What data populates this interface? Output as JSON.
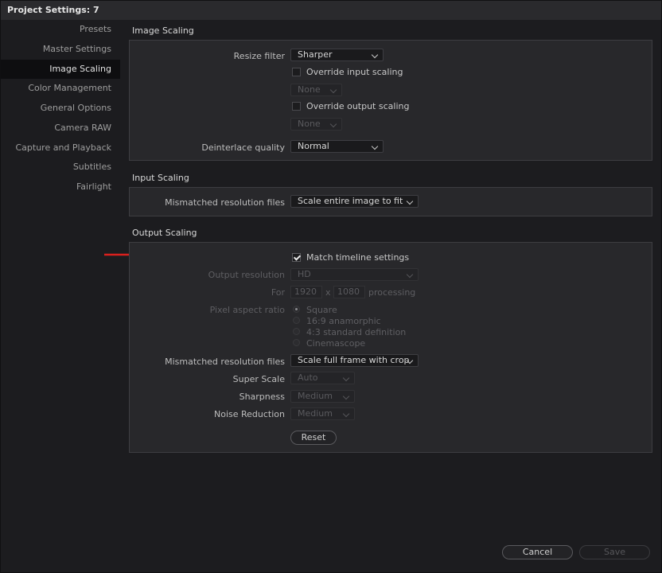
{
  "window": {
    "title": "Project Settings:  7"
  },
  "sidebar": {
    "items": [
      {
        "label": "Presets",
        "active": false
      },
      {
        "label": "Master Settings",
        "active": false
      },
      {
        "label": "Image Scaling",
        "active": true
      },
      {
        "label": "Color Management",
        "active": false
      },
      {
        "label": "General Options",
        "active": false
      },
      {
        "label": "Camera RAW",
        "active": false
      },
      {
        "label": "Capture and Playback",
        "active": false
      },
      {
        "label": "Subtitles",
        "active": false
      },
      {
        "label": "Fairlight",
        "active": false
      }
    ]
  },
  "image_scaling": {
    "section_title": "Image Scaling",
    "resize_filter": {
      "label": "Resize filter",
      "value": "Sharper"
    },
    "override_input": {
      "label": "Override input scaling",
      "checked": false,
      "value": "None"
    },
    "override_output": {
      "label": "Override output scaling",
      "checked": false,
      "value": "None"
    },
    "deinterlace": {
      "label": "Deinterlace quality",
      "value": "Normal"
    }
  },
  "input_scaling": {
    "section_title": "Input Scaling",
    "mismatched": {
      "label": "Mismatched resolution files",
      "value": "Scale entire image to fit"
    }
  },
  "output_scaling": {
    "section_title": "Output Scaling",
    "match_timeline": {
      "label": "Match timeline settings",
      "checked": true
    },
    "output_resolution": {
      "label": "Output resolution",
      "value": "HD"
    },
    "for": {
      "label": "For",
      "width": "1920",
      "x": "x",
      "height": "1080",
      "suffix": "processing"
    },
    "pixel_aspect": {
      "label": "Pixel aspect ratio",
      "options": [
        "Square",
        "16:9 anamorphic",
        "4:3 standard definition",
        "Cinemascope"
      ],
      "selected": "Square"
    },
    "mismatched": {
      "label": "Mismatched resolution files",
      "value": "Scale full frame with crop"
    },
    "super_scale": {
      "label": "Super Scale",
      "value": "Auto"
    },
    "sharpness": {
      "label": "Sharpness",
      "value": "Medium"
    },
    "noise_reduction": {
      "label": "Noise Reduction",
      "value": "Medium"
    },
    "reset_label": "Reset"
  },
  "footer": {
    "cancel_label": "Cancel",
    "save_label": "Save"
  },
  "colors": {
    "accent_arrow": "#d9201d",
    "background": "#1c1c1f",
    "panel": "#28282b"
  }
}
